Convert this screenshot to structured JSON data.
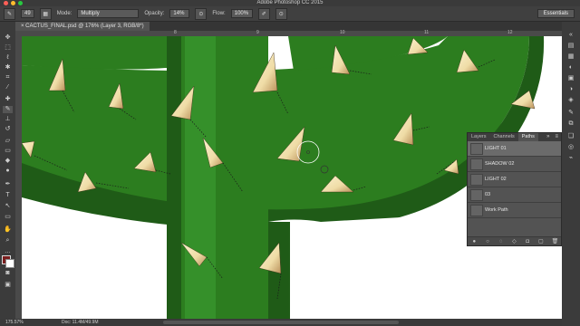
{
  "app": {
    "title": "Adobe Photoshop CC 2015"
  },
  "options_bar": {
    "brush_size": "49",
    "mode_label": "Mode:",
    "mode_value": "Multiply",
    "opacity_label": "Opacity:",
    "opacity_value": "14%",
    "flow_label": "Flow:",
    "flow_value": "100%",
    "workspace": "Essentials"
  },
  "document": {
    "tab_label": "CACTUS_FINAL.psd @ 176% (Layer 3, RGB/8*)"
  },
  "ruler": {
    "top_ticks": [
      "8",
      "9",
      "10",
      "11",
      "12"
    ]
  },
  "status_bar": {
    "zoom": "175.57%",
    "doc": "Doc: 11.4M/49.9M"
  },
  "paths_panel": {
    "tabs": [
      "Layers",
      "Channels",
      "Paths"
    ],
    "active_tab": "Paths",
    "items": [
      {
        "name": "LIGHT 01",
        "selected": true
      },
      {
        "name": "SHADOW 02",
        "selected": false
      },
      {
        "name": "LIGHT 02",
        "selected": false
      },
      {
        "name": "03",
        "selected": false
      },
      {
        "name": "Work Path",
        "selected": false
      }
    ]
  },
  "colors": {
    "cactus_green": "#2c7d1f",
    "cactus_dark": "#1f5b17",
    "spine": "#f1e3b8",
    "foreground_swatch": "#7a1d1d",
    "background_swatch": "#ffffff"
  },
  "icons": {
    "tools": [
      "move-icon",
      "marquee-icon",
      "lasso-icon",
      "quick-select-icon",
      "crop-icon",
      "eyedropper-icon",
      "healing-icon",
      "brush-icon",
      "stamp-icon",
      "history-brush-icon",
      "eraser-icon",
      "gradient-icon",
      "blur-icon",
      "dodge-icon",
      "pen-icon",
      "type-icon",
      "path-select-icon",
      "shape-icon",
      "hand-icon",
      "zoom-icon"
    ]
  }
}
